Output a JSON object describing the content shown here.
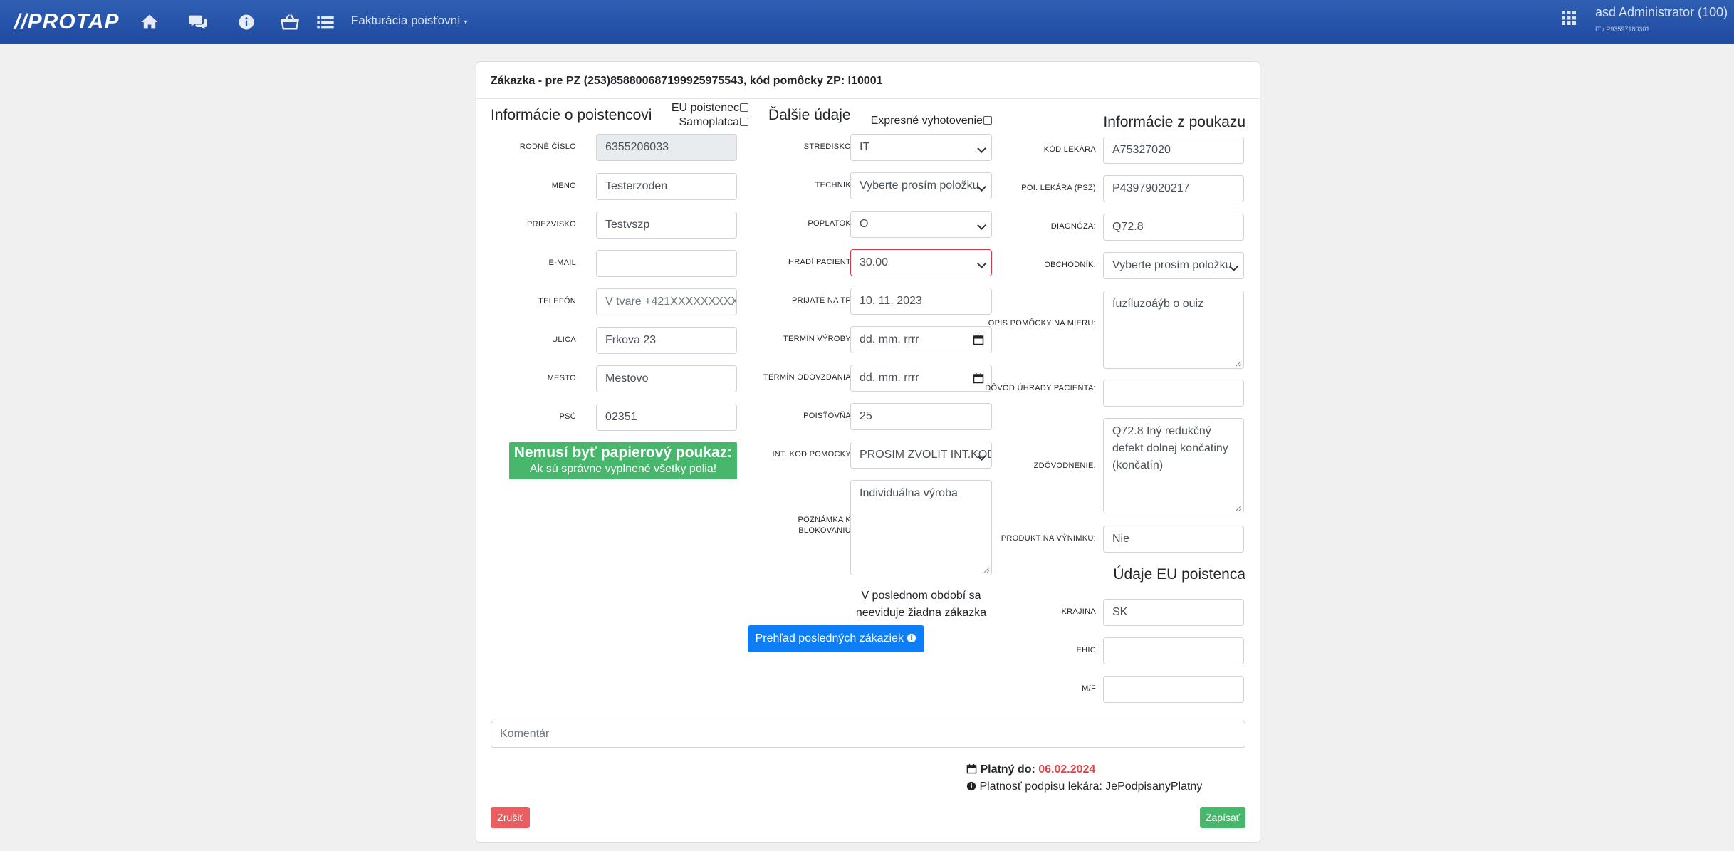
{
  "navbar": {
    "brand": "//PROTAP",
    "dropdown_label": "Fakturácia poisťovní",
    "user_name": "asd Administrator (100)",
    "user_sub": "IT / P93597180301",
    "icons": [
      "home-icon",
      "comments-icon",
      "info-icon",
      "basket-icon",
      "list-icon",
      "grid-icon"
    ]
  },
  "card": {
    "header": "Zákazka - pre PZ (253)858800687199925975543, kód pomôcky ZP: I10001"
  },
  "insured": {
    "title": "Informácie o poistencovi",
    "eu_label": "EU poistenec",
    "self_pay_label": "Samoplatca",
    "fields": {
      "rodne_cislo": {
        "label": "Rodné číslo",
        "value": "6355206033"
      },
      "meno": {
        "label": "Meno",
        "value": "Testerzoden"
      },
      "priezvisko": {
        "label": "Priezvisko",
        "value": "Testvszp"
      },
      "email": {
        "label": "E-mail",
        "value": ""
      },
      "telefon": {
        "label": "Telefón",
        "placeholder": "V tvare +421XXXXXXXXX"
      },
      "ulica": {
        "label": "Ulica",
        "value": "Frkova 23"
      },
      "mesto": {
        "label": "Mesto",
        "value": "Mestovo"
      },
      "psc": {
        "label": "PSČ",
        "value": "02351"
      }
    },
    "notice_line1": "Nemusí byť papierový poukaz:",
    "notice_line2": "Ak sú správne vyplnené všetky polia!"
  },
  "more": {
    "title": "Ďalšie údaje",
    "express_label": "Expresné vyhotovenie",
    "fields": {
      "stredisko": {
        "label": "Stredisko",
        "value": "IT"
      },
      "technik": {
        "label": "Technik",
        "value": "Vyberte prosím položku"
      },
      "poplatok": {
        "label": "Poplatok",
        "value": "O"
      },
      "hradi_pacient": {
        "label": "Hradí pacient",
        "value": "30.00"
      },
      "prijate_na_tp": {
        "label": "Prijaté na TP",
        "value": "10. 11. 2023"
      },
      "termin_vyroby": {
        "label": "Termín výroby",
        "value": "dd. mm. rrrr"
      },
      "termin_odovzdania": {
        "label": "Termín odovzdania",
        "value": "dd. mm. rrrr"
      },
      "poistovna": {
        "label": "Poisťovňa",
        "value": "25"
      },
      "int_kod": {
        "label": "Int. kod pomocky",
        "value": "PROSIM ZVOLIT INT.KOD"
      },
      "poznamka": {
        "label": "Poznámka k blokovaniu",
        "value": "Individuálna výroba"
      }
    },
    "last_period_note": "V poslednom období sa neeviduje žiadna zákazka",
    "history_button": "Prehľad posledných zákaziek"
  },
  "voucher": {
    "title": "Informácie z poukazu",
    "fields": {
      "kod_lekara": {
        "label": "Kód lekára",
        "value": "A75327020"
      },
      "poi_lekara": {
        "label": "Poi. lekára (PSZ)",
        "value": "P43979020217"
      },
      "diagnoza": {
        "label": "Diagnóza:",
        "value": "Q72.8"
      },
      "obchodnik": {
        "label": "Obchodník:",
        "value": "Vyberte prosím položku"
      },
      "opis": {
        "label": "Opis pomôcky na mieru:",
        "value": "íuzíluzoáýb o ouiz"
      },
      "dovod": {
        "label": "Dôvod úhrady pacienta:",
        "value": ""
      },
      "zdovodnenie": {
        "label": "Zdôvodnenie:",
        "value": "Q72.8 Iný redukčný defekt dolnej končatiny (končatín)"
      },
      "produkt": {
        "label": "Produkt na výnimku:",
        "value": "Nie"
      }
    }
  },
  "eu": {
    "title": "Údaje EU poistenca",
    "fields": {
      "krajina": {
        "label": "Krajina",
        "value": "SK"
      },
      "ehic": {
        "label": "EHIC",
        "value": ""
      },
      "mf": {
        "label": "M/F",
        "value": ""
      }
    }
  },
  "comment": {
    "placeholder": "Komentár"
  },
  "validity": {
    "label": "Platný do:",
    "date": "06.02.2024",
    "signature_text": "Platnosť podpisu lekára: JePodpisanyPlatny"
  },
  "actions": {
    "cancel": "Zrušiť",
    "save": "Zapísať"
  },
  "colors": {
    "navbar": "#2553a8",
    "primary": "#0d7ef5",
    "success": "#47b76b",
    "danger": "#e95e60",
    "validity_date": "#e0444a"
  }
}
